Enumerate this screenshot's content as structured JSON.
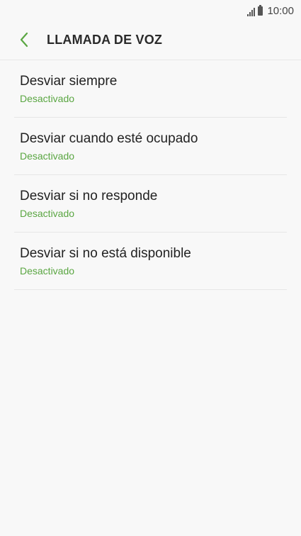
{
  "status_bar": {
    "time": "10:00",
    "signal_icon": "signal-icon",
    "battery_icon": "battery-icon"
  },
  "header": {
    "back_icon": "chevron-left-icon",
    "title": "LLAMADA DE VOZ"
  },
  "colors": {
    "accent": "#5aa642",
    "background": "#f8f8f8",
    "text": "#222222"
  },
  "list": {
    "items": [
      {
        "title": "Desviar siempre",
        "status": "Desactivado"
      },
      {
        "title": "Desviar cuando esté ocupado",
        "status": "Desactivado"
      },
      {
        "title": "Desviar si no responde",
        "status": "Desactivado"
      },
      {
        "title": "Desviar si no está disponible",
        "status": "Desactivado"
      }
    ]
  }
}
